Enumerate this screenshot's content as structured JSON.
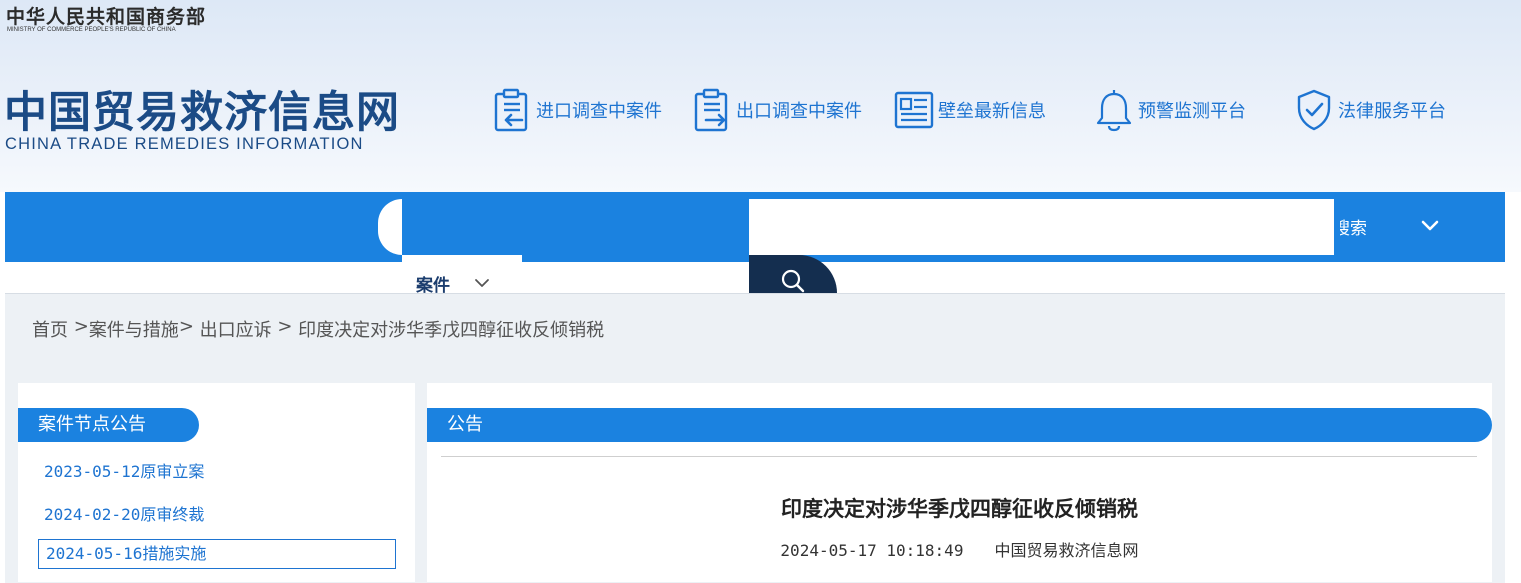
{
  "header": {
    "ministry_cn": "中华人民共和国商务部",
    "ministry_en": "MINISTRY OF COMMERCE PEOPLE'S REPUBLIC OF CHINA",
    "site_cn": "中国贸易救济信息网",
    "site_en": "CHINA TRADE REMEDIES INFORMATION",
    "quick_links": [
      {
        "label": "进口调查中案件",
        "icon": "import-case-icon"
      },
      {
        "label": "出口调查中案件",
        "icon": "export-case-icon"
      },
      {
        "label": "壁垒最新信息",
        "icon": "news-icon"
      },
      {
        "label": "预警监测平台",
        "icon": "bell-icon"
      },
      {
        "label": "法律服务平台",
        "icon": "shield-check-icon"
      }
    ]
  },
  "nav": {
    "search_label_partial": "搜索",
    "type_select": "案件"
  },
  "breadcrumb": {
    "items": [
      "首页",
      "案件与措施",
      "出口应诉",
      "印度决定对涉华季戊四醇征收反倾销税"
    ]
  },
  "sidebar": {
    "title": "案件节点公告",
    "items": [
      {
        "label": "2023-05-12原审立案"
      },
      {
        "label": "2024-02-20原审终裁"
      },
      {
        "label": "2024-05-16措施实施"
      }
    ]
  },
  "main": {
    "section_title": "公告",
    "article_title": "印度决定对涉华季戊四醇征收反倾销税",
    "date": "2024-05-17 10:18:49",
    "source": "中国贸易救济信息网"
  },
  "colors": {
    "primary": "#1b82e0",
    "dark_navy": "#142e4f",
    "link": "#1e74d1",
    "site_title": "#1b4b86"
  }
}
